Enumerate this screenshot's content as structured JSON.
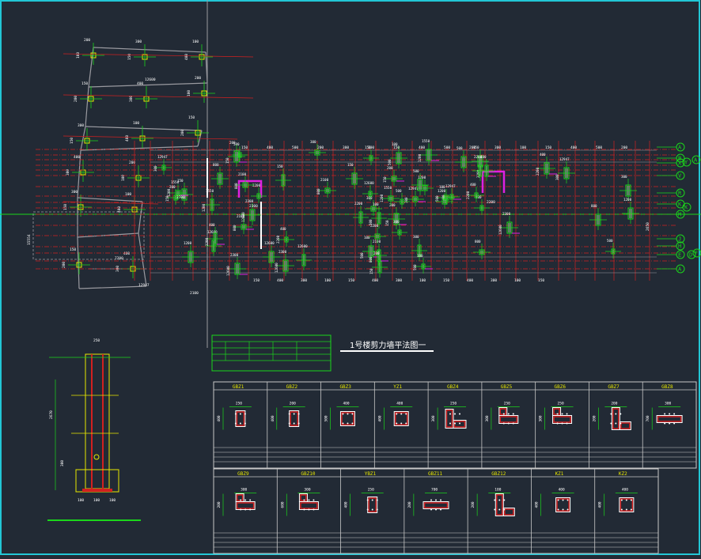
{
  "drawing": {
    "title": "1号楼剪力墙平法图一",
    "colors": {
      "background": "#222a35",
      "border": "#22c7d6",
      "axis_red": "#d22020",
      "wall_gray": "#9a9aa0",
      "dim_green": "#1bd61b",
      "column_yellow": "#e8e800",
      "magenta": "#e020e0",
      "text_white": "#ffffff",
      "frame": "#c8c8c8"
    },
    "grid_axes_right": [
      "A",
      "B",
      "X",
      "Y",
      "V",
      "R",
      "K",
      "M",
      "J",
      "H",
      "E",
      "D",
      "F",
      "A"
    ],
    "dimension_samples": [
      "200",
      "300",
      "100",
      "150",
      "400",
      "500",
      "1550",
      "2200",
      "2300",
      "1200",
      "2100",
      "12600",
      "12947",
      "800"
    ]
  },
  "column_table": {
    "row1": [
      {
        "label": "GBZ1",
        "dims": [
          "250",
          "400"
        ]
      },
      {
        "label": "GBZ2",
        "dims": [
          "200",
          "400"
        ]
      },
      {
        "label": "GBZ3",
        "dims": [
          "400",
          "500"
        ]
      },
      {
        "label": "YZ1",
        "dims": [
          "400",
          "400"
        ]
      },
      {
        "label": "GBZ4",
        "dims": [
          "250",
          "300"
        ]
      },
      {
        "label": "GBZ5",
        "dims": [
          "250",
          "300"
        ]
      },
      {
        "label": "GBZ6",
        "dims": [
          "250",
          "300"
        ]
      },
      {
        "label": "GBZ7",
        "dims": [
          "200",
          "200"
        ]
      },
      {
        "label": "GBZ8",
        "dims": [
          "300",
          "700"
        ]
      }
    ],
    "row2": [
      {
        "label": "GBZ9",
        "dims": [
          "300",
          "200"
        ]
      },
      {
        "label": "GBZ10",
        "dims": [
          "300",
          "600"
        ]
      },
      {
        "label": "YBZ1",
        "dims": [
          "250",
          "400"
        ]
      },
      {
        "label": "GBZ11",
        "dims": [
          "700",
          "200"
        ]
      },
      {
        "label": "GBZ12",
        "dims": [
          "100",
          "200"
        ]
      },
      {
        "label": "KZ1",
        "dims": [
          "400",
          "400"
        ]
      },
      {
        "label": "KZ2",
        "dims": [
          "400",
          "400"
        ]
      }
    ]
  },
  "section_detail": {
    "dims": [
      "250",
      "100",
      "100",
      "100",
      "2670",
      "300"
    ]
  }
}
